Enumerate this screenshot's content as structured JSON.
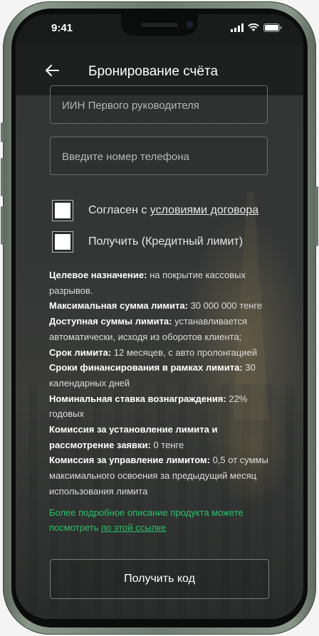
{
  "status_bar": {
    "time": "9:41"
  },
  "header": {
    "title": "Бронирование счёта"
  },
  "form": {
    "iin_placeholder": "ИИН Первого руководителя",
    "phone_placeholder": "Введите номер телефона"
  },
  "checkboxes": {
    "agree_prefix": "Согласен с ",
    "agree_link": "условиями договора",
    "credit_label": "Получить (Кредитный лимит)"
  },
  "info": {
    "purpose_label": "Целевое назначение:",
    "purpose_value": " на покрытие кассовых разрывов.",
    "max_label": "Максимальная сумма лимита:",
    "max_value": " 30 000 000 тенге",
    "available_label": "Доступная суммы лимита:",
    "available_value": " устанавливается автоматически, исходя из оборотов клиента;",
    "term_label": "Срок лимита:",
    "term_value": " 12 месяцев, с авто пролонгацией",
    "financing_label": "Сроки финансирования в рамках лимита:",
    "financing_value": " 30 календарных дней",
    "rate_label": "Номинальная ставка вознаграждения:",
    "rate_value": " 22% годовых",
    "fee_setup_label": "Комиссия за установление лимита и рассмотрение заявки:",
    "fee_setup_value": " 0 тенге",
    "fee_manage_label": "Комиссия за управление лимитом:",
    "fee_manage_value": " 0,5 от суммы максимального освоения за предыдущий месяц использования лимита"
  },
  "more": {
    "text": "Более подробное описание продукта  можете посмотреть ",
    "link": "по этой ссылке"
  },
  "button": {
    "get_code": "Получить код"
  },
  "colors": {
    "accent_green": "#28c46a",
    "background": "#2f3131",
    "header": "#1e2020"
  }
}
